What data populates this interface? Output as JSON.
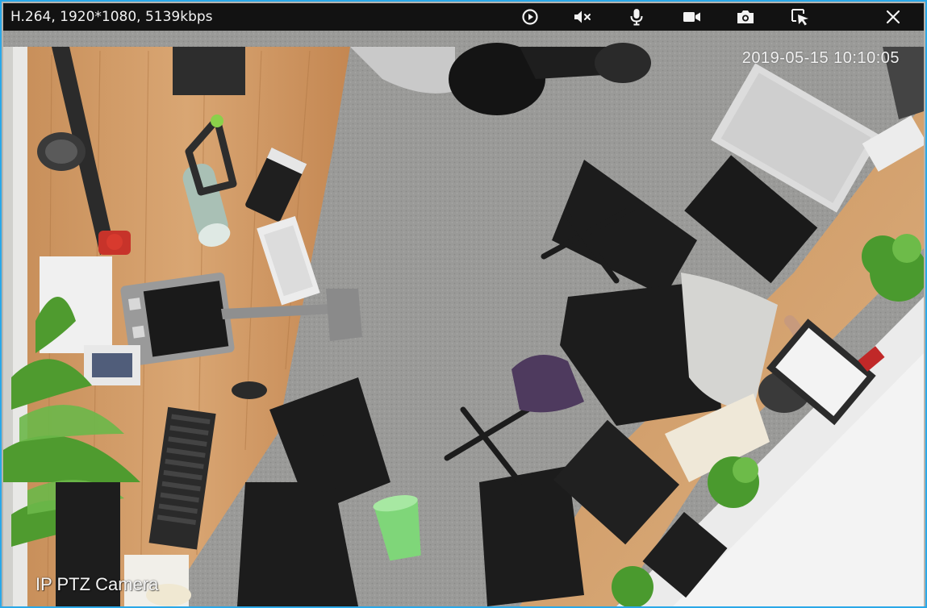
{
  "viewer": {
    "stream_info": "H.264, 1920*1080, 5139kbps",
    "osd_timestamp": "2019-05-15 10:10:05",
    "osd_camera_name": "IP PTZ Camera",
    "accent_color": "#2aa8e8"
  },
  "toolbar": {
    "buttons": [
      {
        "name": "play-button",
        "icon": "play-circle-icon"
      },
      {
        "name": "mute-button",
        "icon": "speaker-muted-icon"
      },
      {
        "name": "talk-button",
        "icon": "microphone-icon"
      },
      {
        "name": "record-button",
        "icon": "video-camera-icon"
      },
      {
        "name": "snapshot-button",
        "icon": "camera-icon"
      },
      {
        "name": "select-region-button",
        "icon": "cursor-select-icon"
      },
      {
        "name": "close-button",
        "icon": "close-icon"
      }
    ]
  }
}
